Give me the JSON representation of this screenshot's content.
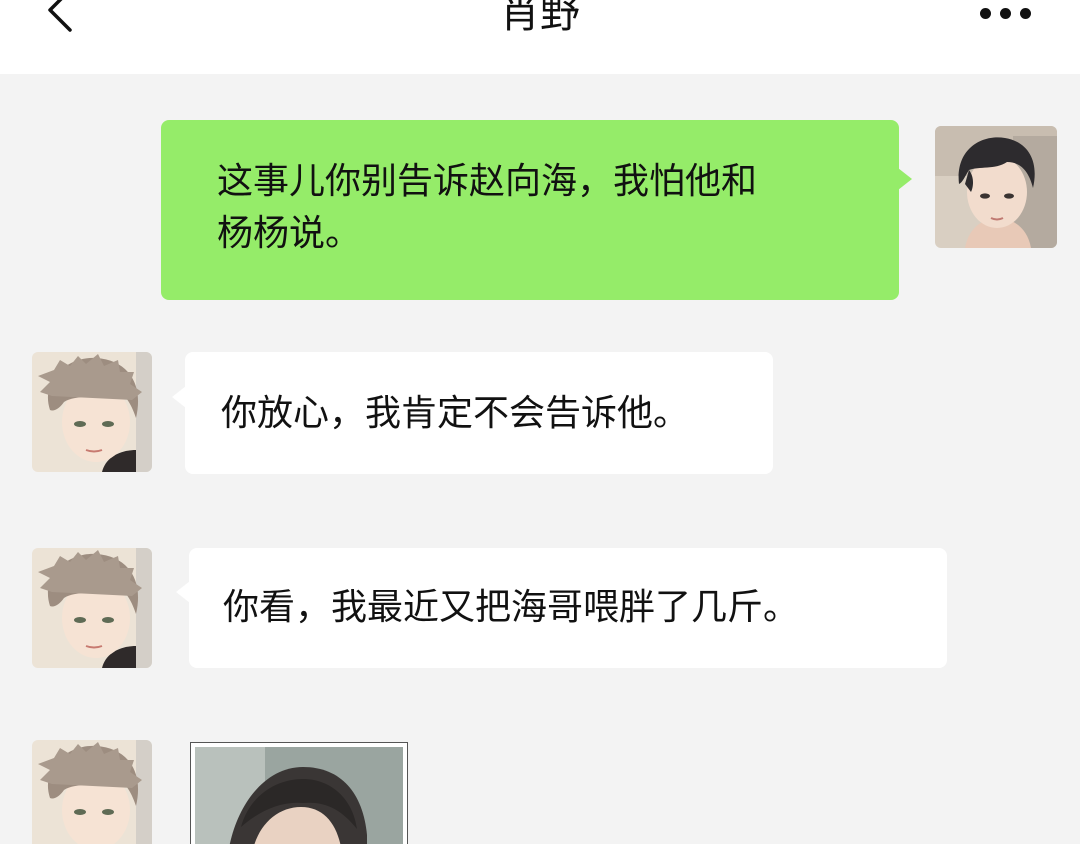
{
  "header": {
    "title": "肖野",
    "back_icon": "chevron-left-icon",
    "more_icon": "more-dots-icon"
  },
  "messages": [
    {
      "sender": "self",
      "text_line1": "这事儿你别告诉赵向海，我怕他和",
      "text_line2": "杨杨说。"
    },
    {
      "sender": "other",
      "text": "你放心，我肯定不会告诉他。"
    },
    {
      "sender": "other",
      "text": "你看，我最近又把海哥喂胖了几斤。"
    },
    {
      "sender": "other",
      "type": "image"
    }
  ],
  "colors": {
    "self_bubble": "#95ec69",
    "other_bubble": "#ffffff",
    "background": "#f3f3f3",
    "header": "#ffffff"
  }
}
